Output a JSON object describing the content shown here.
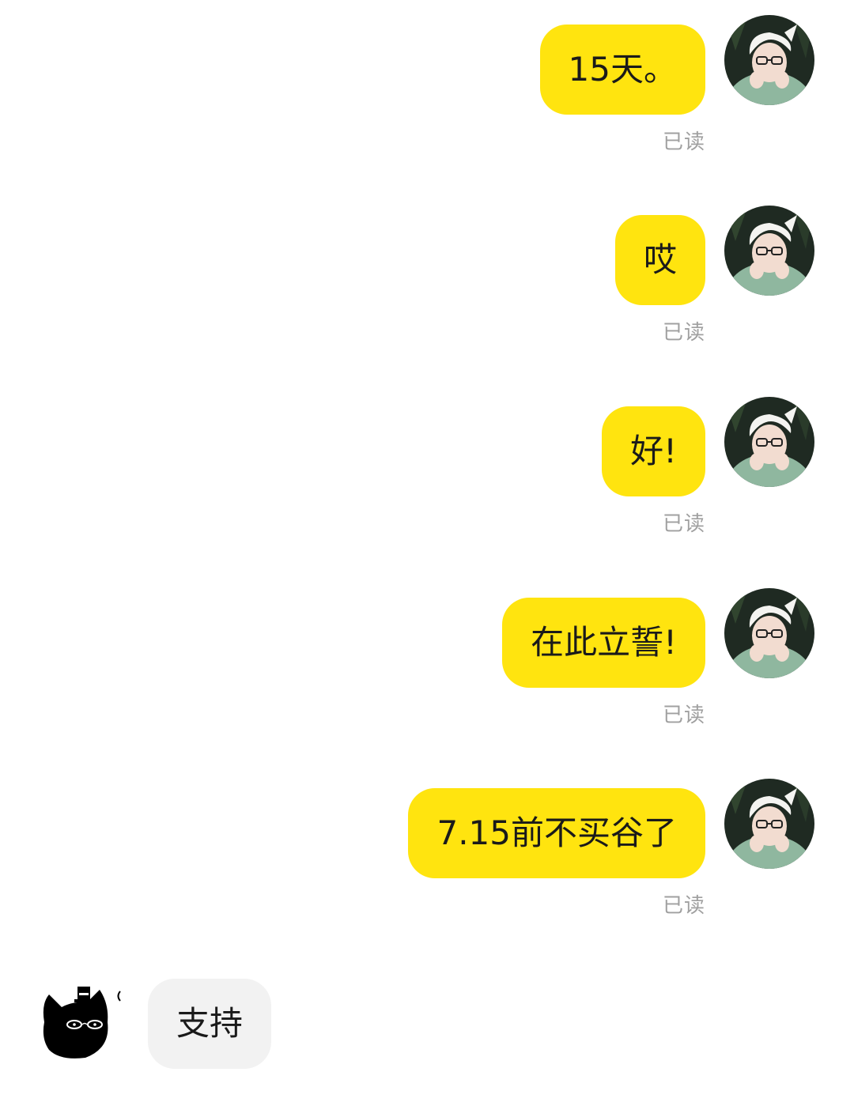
{
  "messages_out": [
    {
      "text": "15天。",
      "status": "已读"
    },
    {
      "text": "哎",
      "status": "已读"
    },
    {
      "text": "好!",
      "status": "已读"
    },
    {
      "text": "在此立誓!",
      "status": "已读"
    },
    {
      "text": "7.15前不买谷了",
      "status": "已读"
    }
  ],
  "message_in": {
    "text": "支持"
  },
  "colors": {
    "out_bubble": "#FFE40F",
    "in_bubble": "#F2F2F2",
    "read_text": "#A0A0A0"
  },
  "icons": {
    "sender_avatar": "user-photo-avatar",
    "receiver_avatar": "black-cat-avatar"
  }
}
